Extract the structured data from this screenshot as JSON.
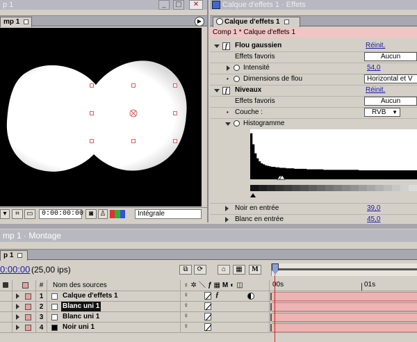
{
  "comp_window": {
    "title": "p 1",
    "tab_label": "mp 1"
  },
  "viewer_toolbar": {
    "timecode": "0:00:00:00",
    "resolution": "Intégrale"
  },
  "effects_window": {
    "title": "Calque d'effets 1 · Effets",
    "tab_label": "Calque d'effets 1",
    "breadcrumb": "Comp 1 * Calque d'effets 1",
    "effects": [
      {
        "name": "Flou gaussien",
        "reset": "Réinit.",
        "favorites_label": "Effets favoris",
        "favorites_value": "Aucun",
        "props": [
          {
            "label": "Intensité",
            "value": "54,0"
          },
          {
            "label": "Dimensions de flou",
            "value": "Horizontal et V"
          }
        ]
      },
      {
        "name": "Niveaux",
        "reset": "Réinit.",
        "favorites_label": "Effets favoris",
        "favorites_value": "Aucun",
        "props": [
          {
            "label": "Couche :",
            "value": "RVB"
          },
          {
            "label": "Histogramme",
            "value": ""
          },
          {
            "label": "Noir en entrée",
            "value": "39,0"
          },
          {
            "label": "Blanc en entrée",
            "value": "45,0"
          }
        ]
      }
    ],
    "histogram_levels": [
      92,
      70,
      52,
      42,
      36,
      32,
      30,
      28,
      27,
      26,
      25,
      25,
      24,
      24,
      23,
      23,
      23,
      22,
      22,
      22,
      22,
      21,
      21,
      21,
      21,
      21,
      21,
      20,
      20,
      20,
      20,
      20,
      20,
      20,
      20,
      19,
      19,
      19,
      19,
      19,
      19,
      19,
      19,
      19,
      19,
      19,
      19,
      19,
      19,
      19,
      19,
      19,
      18,
      18,
      18,
      18,
      18,
      18,
      18,
      18,
      18,
      18,
      18,
      18,
      18,
      18,
      18,
      18,
      18,
      18,
      18,
      18,
      18,
      18,
      18,
      18,
      18,
      18,
      18,
      18
    ]
  },
  "timeline": {
    "title": "mp 1 · Montage",
    "tab_label": "p 1",
    "timecode": "0:00:00",
    "fps": "(25,00 ips)",
    "column_header_num": "#",
    "column_header_source": "Nom des sources",
    "time_labels": [
      "00s",
      "01s"
    ],
    "layers": [
      {
        "num": "1",
        "name": "Calque d'effets 1",
        "label_color": "#e8a0a0",
        "swatch": "#ffffff",
        "selected": false,
        "fx": true
      },
      {
        "num": "2",
        "name": "Blanc uni 1",
        "label_color": "#e8a0a0",
        "swatch": "#ffffff",
        "selected": true,
        "fx": false
      },
      {
        "num": "3",
        "name": "Blanc uni 1",
        "label_color": "#e8a0a0",
        "swatch": "#ffffff",
        "selected": false,
        "fx": false
      },
      {
        "num": "4",
        "name": "Noir uni 1",
        "label_color": "#e8a0a0",
        "swatch": "#000000",
        "selected": false,
        "fx": false
      }
    ]
  },
  "colors": {
    "titlebar_active": "#7a96df",
    "panel": "#d4d0c8",
    "layer_bar": "#eeb4b4",
    "playhead": "#d02020",
    "link": "#1a1aa8"
  }
}
